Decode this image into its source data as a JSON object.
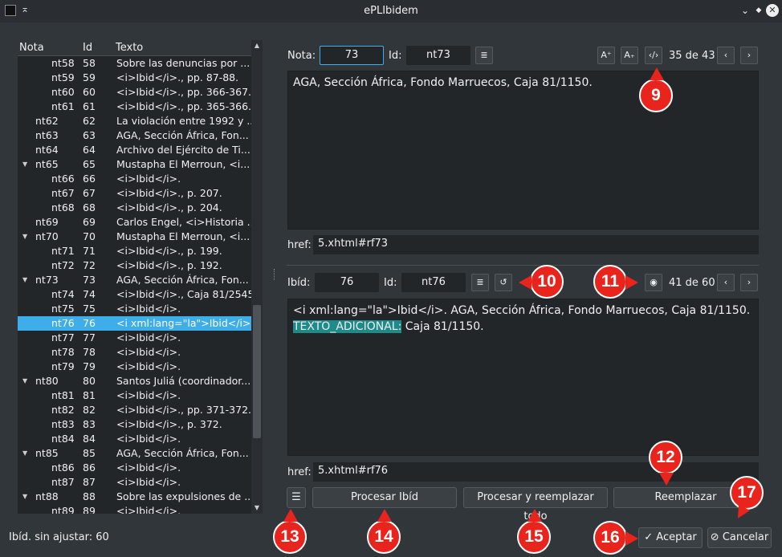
{
  "window": {
    "title": "ePLIbidem",
    "pin_icon": "⌅",
    "collapse_icon": "⌄",
    "restore_icon": "◆",
    "close_icon": "✕"
  },
  "tree": {
    "headers": {
      "nota": "Nota",
      "id": "Id",
      "texto": "Texto"
    },
    "rows": [
      {
        "nota": "nt58",
        "id": "58",
        "texto": "Sobre las denuncias por ...",
        "level": 2,
        "expandable": false,
        "selected": false
      },
      {
        "nota": "nt59",
        "id": "59",
        "texto": "<i>Ibid</i>., pp. 87-88.",
        "level": 2,
        "expandable": false,
        "selected": false
      },
      {
        "nota": "nt60",
        "id": "60",
        "texto": "<i>Ibid</i>., pp. 366-367.",
        "level": 2,
        "expandable": false,
        "selected": false
      },
      {
        "nota": "nt61",
        "id": "61",
        "texto": "<i>Ibid</i>., pp. 365-366.",
        "level": 2,
        "expandable": false,
        "selected": false
      },
      {
        "nota": "nt62",
        "id": "62",
        "texto": "La violación entre 1992 y ...",
        "level": 1,
        "expandable": false,
        "selected": false
      },
      {
        "nota": "nt63",
        "id": "63",
        "texto": "AGA, Sección África, Fon...",
        "level": 1,
        "expandable": false,
        "selected": false
      },
      {
        "nota": "nt64",
        "id": "64",
        "texto": "Archivo del Ejército de Ti...",
        "level": 1,
        "expandable": false,
        "selected": false
      },
      {
        "nota": "nt65",
        "id": "65",
        "texto": "Mustapha El Merroun, <i...",
        "level": 1,
        "expandable": true,
        "selected": false
      },
      {
        "nota": "nt66",
        "id": "66",
        "texto": "<i>Ibid</i>.",
        "level": 2,
        "expandable": false,
        "selected": false
      },
      {
        "nota": "nt67",
        "id": "67",
        "texto": "<i>Ibid</i>., p. 207.",
        "level": 2,
        "expandable": false,
        "selected": false
      },
      {
        "nota": "nt68",
        "id": "68",
        "texto": "<i>Ibid</i>., p. 204.",
        "level": 2,
        "expandable": false,
        "selected": false
      },
      {
        "nota": "nt69",
        "id": "69",
        "texto": "Carlos Engel, <i>Historia ...",
        "level": 1,
        "expandable": false,
        "selected": false
      },
      {
        "nota": "nt70",
        "id": "70",
        "texto": "Mustapha El Merroun, <i...",
        "level": 1,
        "expandable": true,
        "selected": false
      },
      {
        "nota": "nt71",
        "id": "71",
        "texto": "<i>Ibid</i>., p. 199.",
        "level": 2,
        "expandable": false,
        "selected": false
      },
      {
        "nota": "nt72",
        "id": "72",
        "texto": "<i>Ibid</i>., p. 192.",
        "level": 2,
        "expandable": false,
        "selected": false
      },
      {
        "nota": "nt73",
        "id": "73",
        "texto": "AGA, Sección África, Fon...",
        "level": 1,
        "expandable": true,
        "selected": false
      },
      {
        "nota": "nt74",
        "id": "74",
        "texto": "<i>Ibid</i>., Caja 81/2545.",
        "level": 2,
        "expandable": false,
        "selected": false
      },
      {
        "nota": "nt75",
        "id": "75",
        "texto": "<i>Ibid</i>.",
        "level": 2,
        "expandable": false,
        "selected": false
      },
      {
        "nota": "nt76",
        "id": "76",
        "texto": "<i xml:lang=\"la\">Ibid</i>. ...",
        "level": 2,
        "expandable": false,
        "selected": true
      },
      {
        "nota": "nt77",
        "id": "77",
        "texto": "<i>Ibid</i>.",
        "level": 2,
        "expandable": false,
        "selected": false
      },
      {
        "nota": "nt78",
        "id": "78",
        "texto": "<i>Ibid</i>.",
        "level": 2,
        "expandable": false,
        "selected": false
      },
      {
        "nota": "nt79",
        "id": "79",
        "texto": "<i>Ibid</i>.",
        "level": 2,
        "expandable": false,
        "selected": false
      },
      {
        "nota": "nt80",
        "id": "80",
        "texto": "Santos Juliá (coordinador...",
        "level": 1,
        "expandable": true,
        "selected": false
      },
      {
        "nota": "nt81",
        "id": "81",
        "texto": "<i>Ibid</i>.",
        "level": 2,
        "expandable": false,
        "selected": false
      },
      {
        "nota": "nt82",
        "id": "82",
        "texto": "<i>Ibid</i>., pp. 371-372.",
        "level": 2,
        "expandable": false,
        "selected": false
      },
      {
        "nota": "nt83",
        "id": "83",
        "texto": "<i>Ibid</i>., p. 372.",
        "level": 2,
        "expandable": false,
        "selected": false
      },
      {
        "nota": "nt84",
        "id": "84",
        "texto": "<i>Ibid</i>.",
        "level": 2,
        "expandable": false,
        "selected": false
      },
      {
        "nota": "nt85",
        "id": "85",
        "texto": "AGA, Sección África, Fon...",
        "level": 1,
        "expandable": true,
        "selected": false
      },
      {
        "nota": "nt86",
        "id": "86",
        "texto": "<i>Ibid</i>.",
        "level": 2,
        "expandable": false,
        "selected": false
      },
      {
        "nota": "nt87",
        "id": "87",
        "texto": "<i>Ibid</i>.",
        "level": 2,
        "expandable": false,
        "selected": false
      },
      {
        "nota": "nt88",
        "id": "88",
        "texto": "Sobre las expulsiones de ...",
        "level": 1,
        "expandable": true,
        "selected": false
      },
      {
        "nota": "nt89",
        "id": "89",
        "texto": "<i>Ibid</i>.",
        "level": 2,
        "expandable": false,
        "selected": false
      }
    ]
  },
  "status": "Ibíd. sin ajustar: 60",
  "nota_section": {
    "nota_label": "Nota:",
    "nota_value": "73",
    "id_label": "Id:",
    "id_value": "nt73",
    "format_icon": "≣",
    "font_up_icon": "A⁺",
    "font_down_icon": "A₊",
    "code_icon": "‹/›",
    "counter": "35 de 43",
    "prev_icon": "‹",
    "next_icon": "›",
    "text": "AGA, Sección África, Fondo Marruecos, Caja 81/1150.",
    "href_label": "href:",
    "href_value": "5.xhtml#rf73"
  },
  "ibid_section": {
    "ibid_label": "Ibíd:",
    "ibid_value": "76",
    "id_label": "Id:",
    "id_value": "nt76",
    "format_icon": "≣",
    "undo_icon": "↺",
    "eye_icon": "◉",
    "counter": "41 de 60",
    "prev_icon": "‹",
    "next_icon": "›",
    "text_line1": "<i xml:lang=\"la\">Ibid</i>. AGA, Sección África, Fondo Marruecos, Caja 81/1150.",
    "text_highlight": "TEXTO_ADICIONAL:",
    "text_line2_rest": " Caja 81/1150.",
    "href_label": "href:",
    "href_value": "5.xhtml#rf76"
  },
  "buttons": {
    "menu_icon": "☰",
    "procesar": "Procesar Ibíd",
    "procesar_todo": "Procesar y reemplazar todo",
    "reemplazar": "Reemplazar",
    "aceptar": "Aceptar",
    "aceptar_icon": "✓",
    "cancelar": "Cancelar",
    "cancelar_icon": "⊘"
  },
  "badges": {
    "b9": "9",
    "b10": "10",
    "b11": "11",
    "b12": "12",
    "b13": "13",
    "b14": "14",
    "b15": "15",
    "b16": "16",
    "b17": "17"
  },
  "colors": {
    "accent": "#3daee9",
    "badge": "#e8241c",
    "highlight": "#1e8a8a",
    "bg": "#31363b",
    "field": "#232629"
  }
}
